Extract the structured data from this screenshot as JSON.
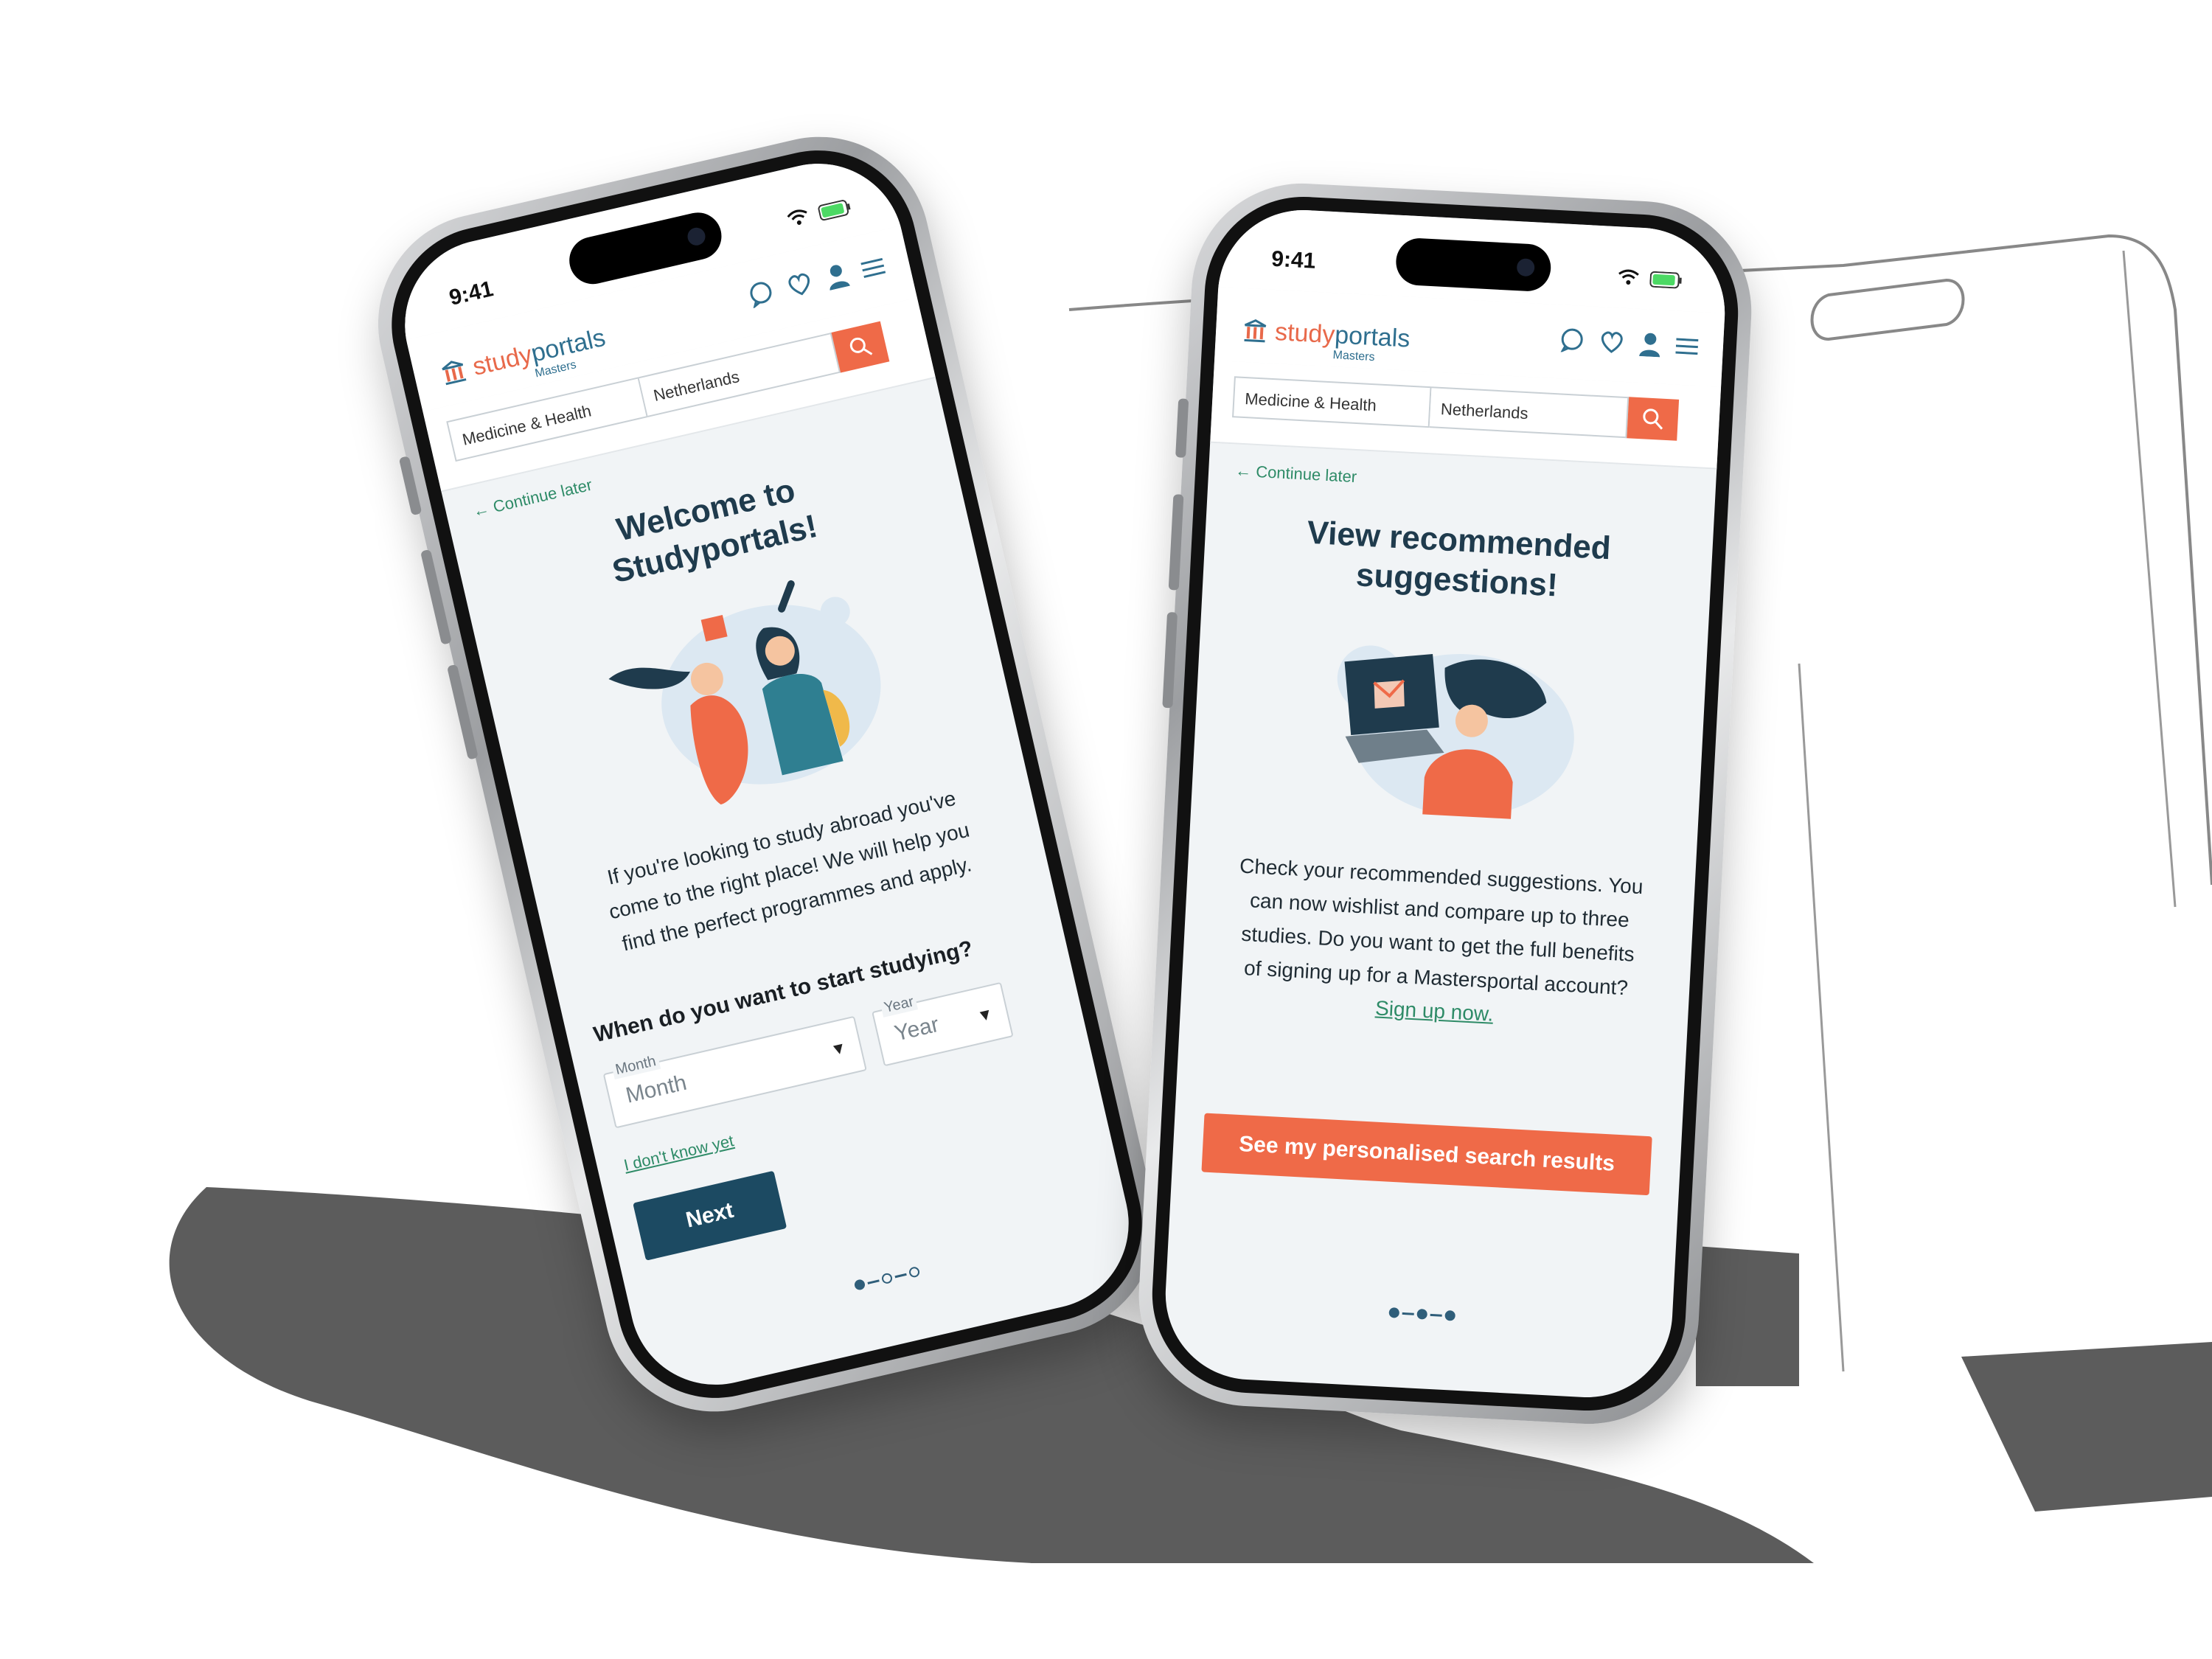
{
  "brand": {
    "name_part1": "study",
    "name_part2": "portals",
    "subtitle": "Masters"
  },
  "colors": {
    "accent": "#ef6a48",
    "primary_dark": "#1c4a62",
    "link_green": "#2e8b67",
    "screen_bg": "#f1f4f6"
  },
  "status_bar": {
    "time": "9:41"
  },
  "header_icons": [
    "chat-icon",
    "heart-icon",
    "user-icon",
    "menu-icon"
  ],
  "search": {
    "discipline": "Medicine & Health",
    "country": "Netherlands",
    "button_icon": "search-icon"
  },
  "screen_left": {
    "continue_later": "Continue later",
    "title_line1": "Welcome to",
    "title_line2": "Studyportals!",
    "body_line1": "If you're looking to study abroad you've",
    "body_line2": "come to the right place! We will help you",
    "body_line3": "find the perfect programmes and apply.",
    "question": "When do you want to start studying?",
    "month_label": "Month",
    "month_value": "Month",
    "year_label": "Year",
    "year_value": "Year",
    "dont_know": "I don't know yet",
    "next_button": "Next",
    "step_current": 1,
    "step_total": 3
  },
  "screen_right": {
    "continue_later": "Continue later",
    "title_line1": "View recommended",
    "title_line2": "suggestions!",
    "body_line1": "Check your recommended suggestions. You",
    "body_line2": "can now wishlist and compare up to three",
    "body_line3": "studies. Do you want to get the full benefits",
    "body_line4": "of signing up for a Mastersportal account?",
    "signup_link": "Sign up now.",
    "cta_button": "See my personalised search results",
    "step_current": 3,
    "step_total": 3
  }
}
